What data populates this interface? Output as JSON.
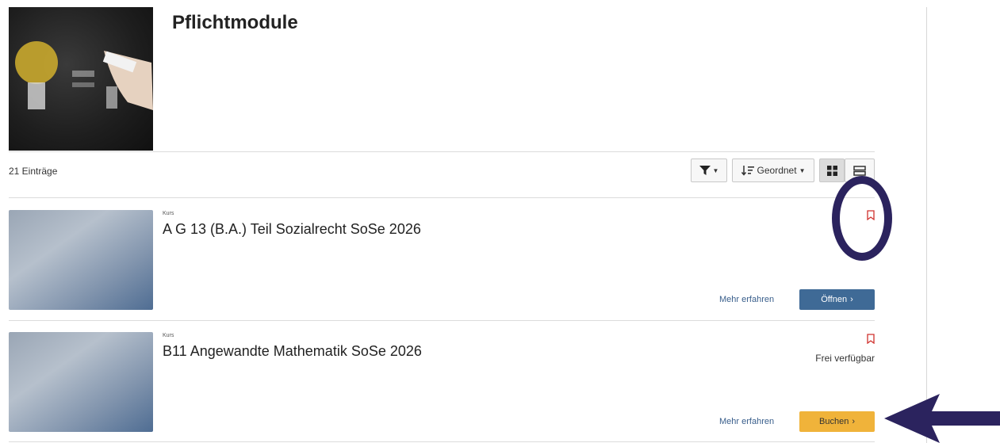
{
  "header": {
    "title": "Pflichtmodule"
  },
  "listing": {
    "count_label": "21 Einträge",
    "sort_label": "Geordnet"
  },
  "cards": [
    {
      "type_label": "Kurs",
      "title": "A G 13 (B.A.) Teil Sozialrecht SoSe 2026",
      "availability": "",
      "more_label": "Mehr erfahren",
      "action_label": "Öffnen"
    },
    {
      "type_label": "Kurs",
      "title": "B11 Angewandte Mathematik SoSe 2026",
      "availability": "Frei verfügbar",
      "more_label": "Mehr erfahren",
      "action_label": "Buchen"
    }
  ],
  "icons": {
    "filter": "filter-icon",
    "sort": "sort-icon",
    "grid_view": "grid-view-icon",
    "list_view": "list-view-icon",
    "bookmark": "bookmark-icon",
    "chevron": "chevron-right-icon"
  },
  "colors": {
    "primary_button": "#3f6a96",
    "book_button": "#f0b33a",
    "bookmark": "#d0312d",
    "link": "#3a5f8c",
    "annotation": "#2b235e"
  }
}
